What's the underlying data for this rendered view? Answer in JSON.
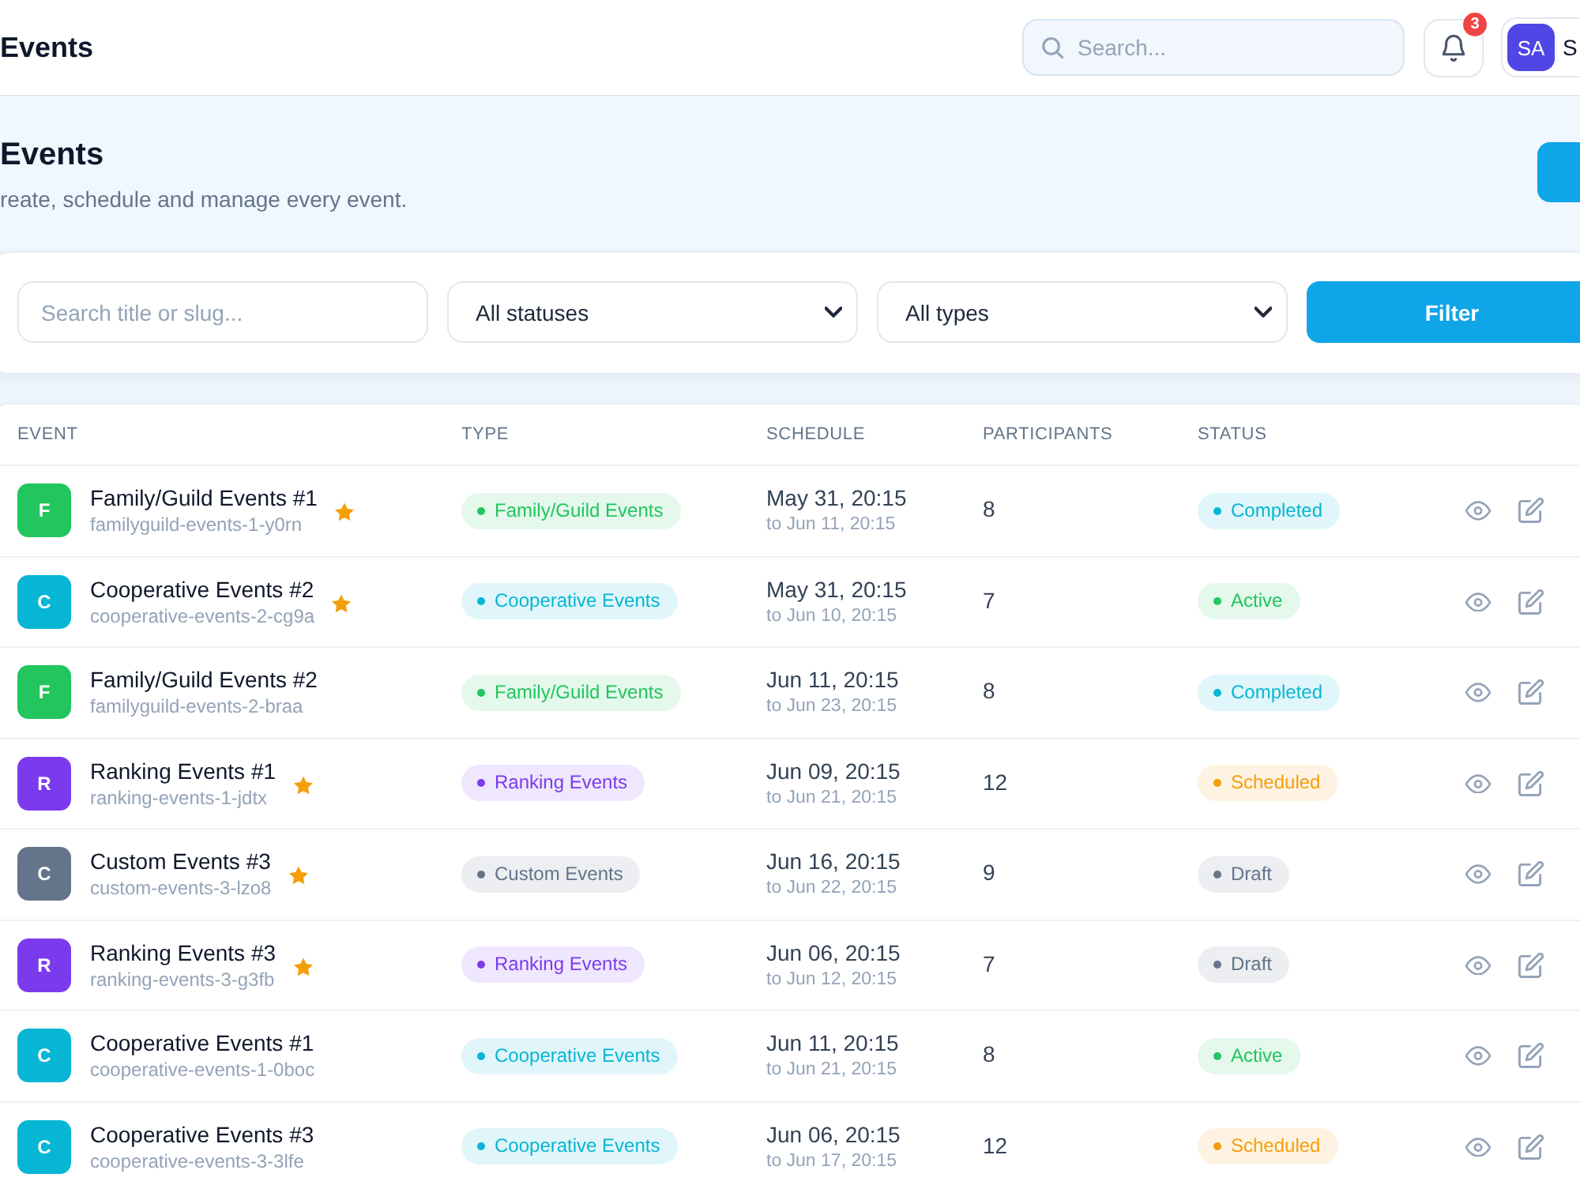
{
  "header": {
    "title": "Events",
    "search": {
      "placeholder": "Search..."
    },
    "notifications": {
      "count": "3"
    },
    "user": {
      "initials": "SA",
      "name": "S"
    }
  },
  "hero": {
    "title": "Events",
    "subtitle": "reate, schedule and manage every event."
  },
  "filters": {
    "search": {
      "placeholder": "Search title or slug..."
    },
    "status_select": {
      "value": "All statuses"
    },
    "type_select": {
      "value": "All types"
    },
    "button": "Filter"
  },
  "table": {
    "columns": [
      "EVENT",
      "TYPE",
      "SCHEDULE",
      "PARTICIPANTS",
      "STATUS"
    ],
    "rows": [
      {
        "initial": "F",
        "title": "Family/Guild Events #1",
        "slug": "familyguild-events-1-y0rn",
        "starred": true,
        "type": {
          "label": "Family/Guild Events",
          "color": "#22c55e"
        },
        "start": "May 31, 20:15",
        "end": "to Jun 11, 20:15",
        "participants": "8",
        "status": {
          "label": "Completed",
          "color": "#06b6d4"
        }
      },
      {
        "initial": "C",
        "title": "Cooperative Events #2",
        "slug": "cooperative-events-2-cg9a",
        "starred": true,
        "type": {
          "label": "Cooperative Events",
          "color": "#06b6d4"
        },
        "start": "May 31, 20:15",
        "end": "to Jun 10, 20:15",
        "participants": "7",
        "status": {
          "label": "Active",
          "color": "#22c55e"
        }
      },
      {
        "initial": "F",
        "title": "Family/Guild Events #2",
        "slug": "familyguild-events-2-braa",
        "starred": false,
        "type": {
          "label": "Family/Guild Events",
          "color": "#22c55e"
        },
        "start": "Jun 11, 20:15",
        "end": "to Jun 23, 20:15",
        "participants": "8",
        "status": {
          "label": "Completed",
          "color": "#06b6d4"
        }
      },
      {
        "initial": "R",
        "title": "Ranking Events #1",
        "slug": "ranking-events-1-jdtx",
        "starred": true,
        "type": {
          "label": "Ranking Events",
          "color": "#7c3aed"
        },
        "start": "Jun 09, 20:15",
        "end": "to Jun 21, 20:15",
        "participants": "12",
        "status": {
          "label": "Scheduled",
          "color": "#f59e0b"
        }
      },
      {
        "initial": "C",
        "title": "Custom Events #3",
        "slug": "custom-events-3-lzo8",
        "starred": true,
        "type": {
          "label": "Custom Events",
          "color": "#64748b"
        },
        "start": "Jun 16, 20:15",
        "end": "to Jun 22, 20:15",
        "participants": "9",
        "status": {
          "label": "Draft",
          "color": "#64748b"
        }
      },
      {
        "initial": "R",
        "title": "Ranking Events #3",
        "slug": "ranking-events-3-g3fb",
        "starred": true,
        "type": {
          "label": "Ranking Events",
          "color": "#7c3aed"
        },
        "start": "Jun 06, 20:15",
        "end": "to Jun 12, 20:15",
        "participants": "7",
        "status": {
          "label": "Draft",
          "color": "#64748b"
        }
      },
      {
        "initial": "C",
        "title": "Cooperative Events #1",
        "slug": "cooperative-events-1-0boc",
        "starred": false,
        "type": {
          "label": "Cooperative Events",
          "color": "#06b6d4"
        },
        "start": "Jun 11, 20:15",
        "end": "to Jun 21, 20:15",
        "participants": "8",
        "status": {
          "label": "Active",
          "color": "#22c55e"
        }
      },
      {
        "initial": "C",
        "title": "Cooperative Events #3",
        "slug": "cooperative-events-3-3lfe",
        "starred": false,
        "type": {
          "label": "Cooperative Events",
          "color": "#06b6d4"
        },
        "start": "Jun 06, 20:15",
        "end": "to Jun 17, 20:15",
        "participants": "12",
        "status": {
          "label": "Scheduled",
          "color": "#f59e0b"
        }
      }
    ]
  }
}
